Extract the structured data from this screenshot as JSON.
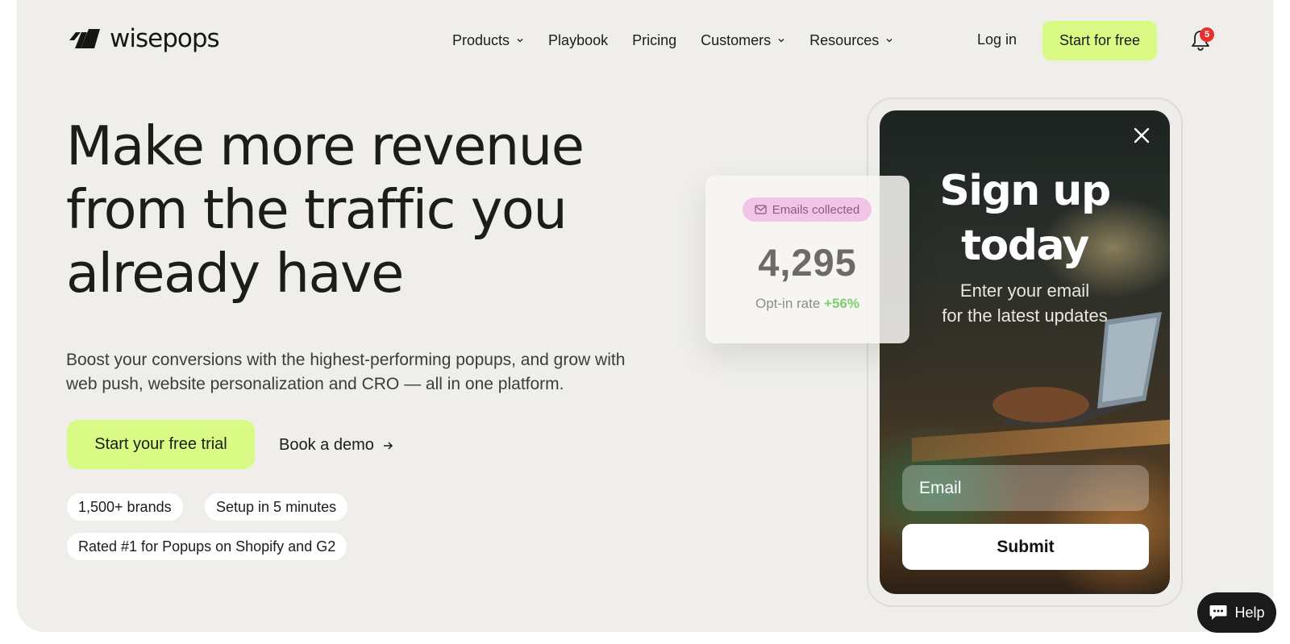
{
  "brand": {
    "name": "wisepops",
    "logo_icon": "wisepops-logo-icon"
  },
  "nav": {
    "items": [
      {
        "label": "Products",
        "has_dropdown": true
      },
      {
        "label": "Playbook",
        "has_dropdown": false
      },
      {
        "label": "Pricing",
        "has_dropdown": false
      },
      {
        "label": "Customers",
        "has_dropdown": true
      },
      {
        "label": "Resources",
        "has_dropdown": true
      }
    ],
    "login_label": "Log in",
    "start_label": "Start for free",
    "notifications_count": "5"
  },
  "hero": {
    "title_lines": [
      "Make more revenue",
      "from the traffic you",
      "already have"
    ],
    "subtitle": "Boost your conversions with the highest-performing popups, and grow with web push, website personalization and CRO — all in one platform.",
    "primary_cta": "Start your free trial",
    "secondary_cta": "Book a demo",
    "badges": [
      "1,500+ brands",
      "Setup in 5 minutes",
      "Rated #1 for Popups on Shopify and G2"
    ]
  },
  "stat_card": {
    "chip_label": "Emails collected",
    "value": "4,295",
    "rate_label": "Opt-in rate",
    "rate_value": "+56%"
  },
  "popup": {
    "title_lines": [
      "Sign up",
      "today"
    ],
    "subtitle_lines": [
      "Enter your email",
      "for the latest updates"
    ],
    "email_placeholder": "Email",
    "submit_label": "Submit"
  },
  "help": {
    "label": "Help"
  },
  "colors": {
    "accent": "#d9fa84",
    "background": "#efeeea",
    "badge": "#e5322d",
    "chip": "#f0c5e8",
    "positive": "#7bcf6e"
  }
}
